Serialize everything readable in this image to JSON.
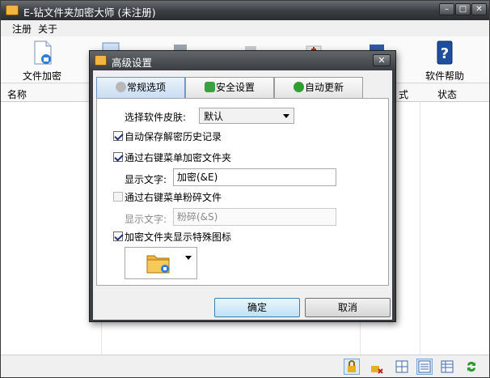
{
  "app": {
    "title": "E-钻文件夹加密大师 (未注册)"
  },
  "menu": {
    "items": [
      "注册",
      "关于"
    ]
  },
  "toolbar": {
    "buttons": [
      {
        "label": "文件加密",
        "icon": "file-encrypt-icon"
      },
      {
        "label": "",
        "icon": "folder-icon"
      },
      {
        "label": "",
        "icon": "clipboard-icon"
      },
      {
        "label": "",
        "icon": "disk-icon"
      },
      {
        "label": "",
        "icon": "medkit-icon"
      },
      {
        "label": "",
        "icon": "monitor-icon"
      },
      {
        "label": "软件帮助",
        "icon": "help-book-icon"
      }
    ]
  },
  "list": {
    "columns": [
      "名称",
      "式",
      "状态"
    ]
  },
  "dialog": {
    "title": "高级设置",
    "tabs": [
      {
        "label": "常规选项",
        "icon": "gear-icon",
        "active": true
      },
      {
        "label": "安全设置",
        "icon": "shield-icon",
        "active": false
      },
      {
        "label": "自动更新",
        "icon": "update-globe-icon",
        "active": false
      }
    ],
    "skin": {
      "label": "选择软件皮肤:",
      "value": "默认"
    },
    "options": {
      "save_history": {
        "label": "自动保存解密历史记录",
        "checked": true
      },
      "context_encrypt": {
        "label": "通过右键菜单加密文件夹",
        "checked": true
      },
      "encrypt_text": {
        "label": "显示文字:",
        "value": "加密(&E)"
      },
      "context_shred": {
        "label": "通过右键菜单粉碎文件",
        "checked": false
      },
      "shred_text": {
        "label": "显示文字:",
        "value": "粉碎(&S)"
      },
      "special_icon": {
        "label": "加密文件夹显示特殊图标",
        "checked": true
      }
    },
    "buttons": {
      "ok": "确定",
      "cancel": "取消"
    }
  },
  "colors": {
    "accent": "#6b92c0",
    "titlebar": "#3c3f43",
    "folder": "#f2b640"
  }
}
